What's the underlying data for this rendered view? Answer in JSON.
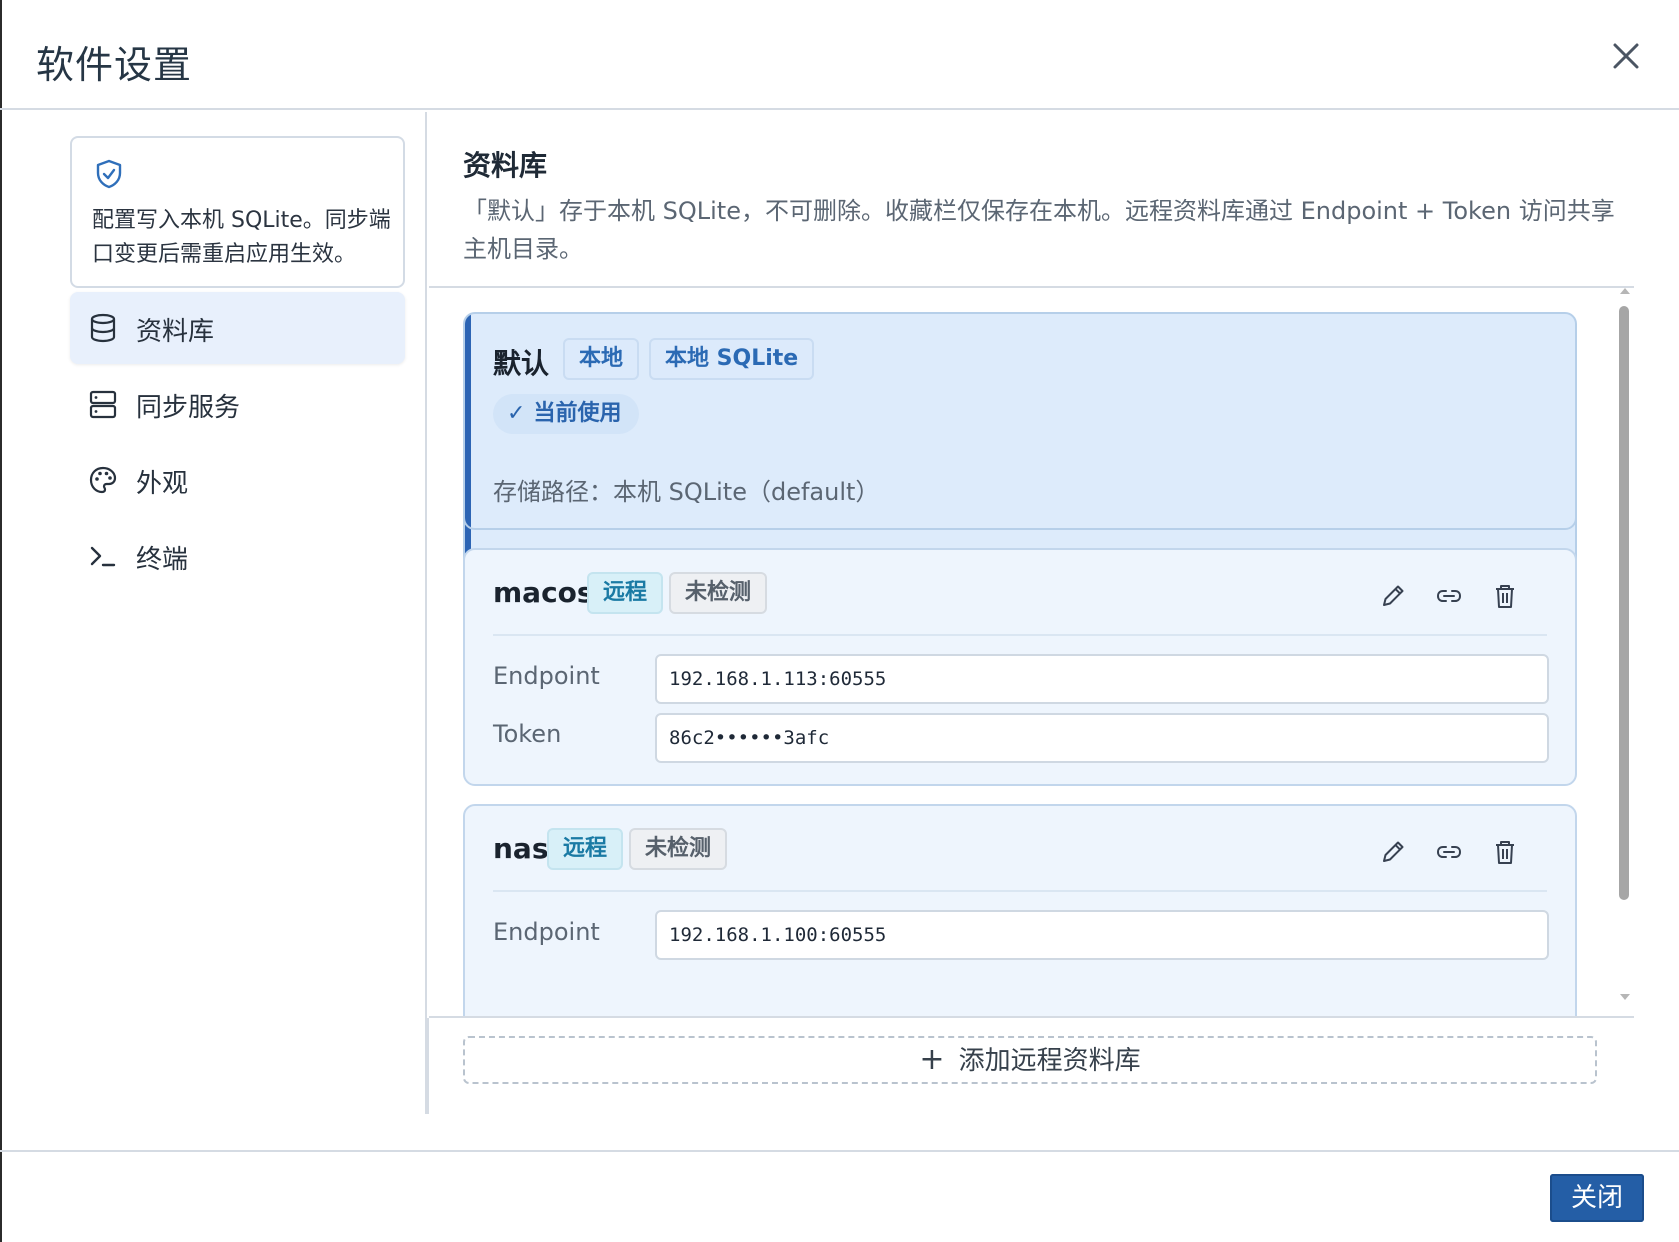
{
  "dialog": {
    "title": "软件设置",
    "close_icon": "close-icon",
    "footer_close_label": "关闭",
    "accent_color": "#245ea6"
  },
  "sidebar": {
    "info_icon": "shield-check-icon",
    "info_text": "配置写入本机 SQLite。同步端口变更后需重启应用生效。",
    "items": [
      {
        "label": "资料库",
        "icon": "database-icon",
        "active": true
      },
      {
        "label": "同步服务",
        "icon": "server-icon",
        "active": false
      },
      {
        "label": "外观",
        "icon": "palette-icon",
        "active": false
      },
      {
        "label": "终端",
        "icon": "terminal-icon",
        "active": false
      }
    ]
  },
  "main": {
    "title": "资料库",
    "description": "「默认」存于本机 SQLite，不可删除。收藏栏仅保存在本机。远程资料库通过 Endpoint + Token 访问共享主机目录。",
    "add_button_label": "添加远程资料库",
    "add_icon": "plus-icon",
    "databases": [
      {
        "name": "默认",
        "badges": [
          "本地",
          "本地 SQLite"
        ],
        "current_label": "当前使用",
        "storage_path_label": "存储路径：本机 SQLite（default）"
      },
      {
        "name": "macos",
        "badges": [
          "远程",
          "未检测"
        ],
        "endpoint_label": "Endpoint",
        "endpoint_value": "192.168.1.113:60555",
        "token_label": "Token",
        "token_value": "86c2••••••3afc",
        "actions": [
          "edit-icon",
          "link-icon",
          "trash-icon"
        ]
      },
      {
        "name": "nas",
        "badges": [
          "远程",
          "未检测"
        ],
        "endpoint_label": "Endpoint",
        "endpoint_value": "192.168.1.100:60555",
        "actions": [
          "edit-icon",
          "link-icon",
          "trash-icon"
        ]
      }
    ]
  }
}
